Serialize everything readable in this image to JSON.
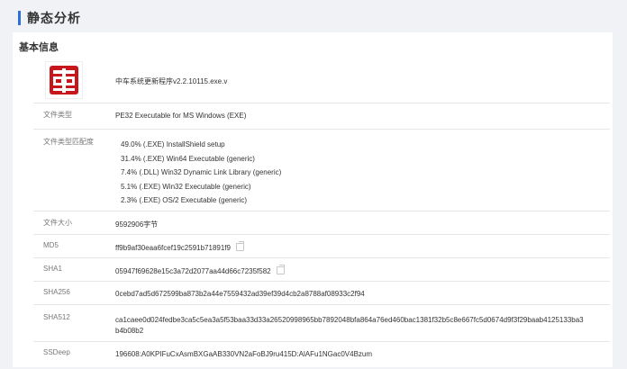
{
  "section": {
    "title": "静态分析"
  },
  "basic_info": {
    "title": "基本信息",
    "file_name": "中车系统更新程序v2.2.10115.exe.v",
    "logo_icon": "crrc-logo-icon",
    "rows": {
      "file_type": {
        "label": "文件类型",
        "value": "PE32 Executable for MS Windows (EXE)"
      },
      "type_match": {
        "label": "文件类型匹配度",
        "items": [
          "49.0% (.EXE) InstallShield setup",
          "31.4% (.EXE) Win64 Executable (generic)",
          "7.4% (.DLL) Win32 Dynamic Link Library (generic)",
          "5.1% (.EXE) Win32 Executable (generic)",
          "2.3% (.EXE) OS/2 Executable (generic)"
        ]
      },
      "file_size": {
        "label": "文件大小",
        "value": "9592906字节"
      },
      "md5": {
        "label": "MD5",
        "value": "ff9b9af30eaa6fcef19c2591b71891f9"
      },
      "sha1": {
        "label": "SHA1",
        "value": "05947f69628e15c3a72d2077aa44d66c7235f582"
      },
      "sha256": {
        "label": "SHA256",
        "value": "0cebd7ad5d672599ba873b2a44e7559432ad39ef39d4cb2a8788af08933c2f94"
      },
      "sha512": {
        "label": "SHA512",
        "value": "ca1caee0d024fedbe3ca5c5ea3a5f53baa33d33a26520998965bb7892048bfa864a76ed460bac1381f32b5c8e667fc5d0674d9f3f29baab4125133ba3b4b08b2"
      },
      "ssdeep": {
        "label": "SSDeep",
        "value": "196608:A0KPIFuCxAsmBXGaAB330VN2aFoBJ9ru415D:AlAFu1NGac0V4Bzum"
      }
    }
  },
  "colors": {
    "accent": "#2f6fd8",
    "logo_red": "#c8161d",
    "background": "#f0f2f5",
    "card": "#ffffff"
  }
}
